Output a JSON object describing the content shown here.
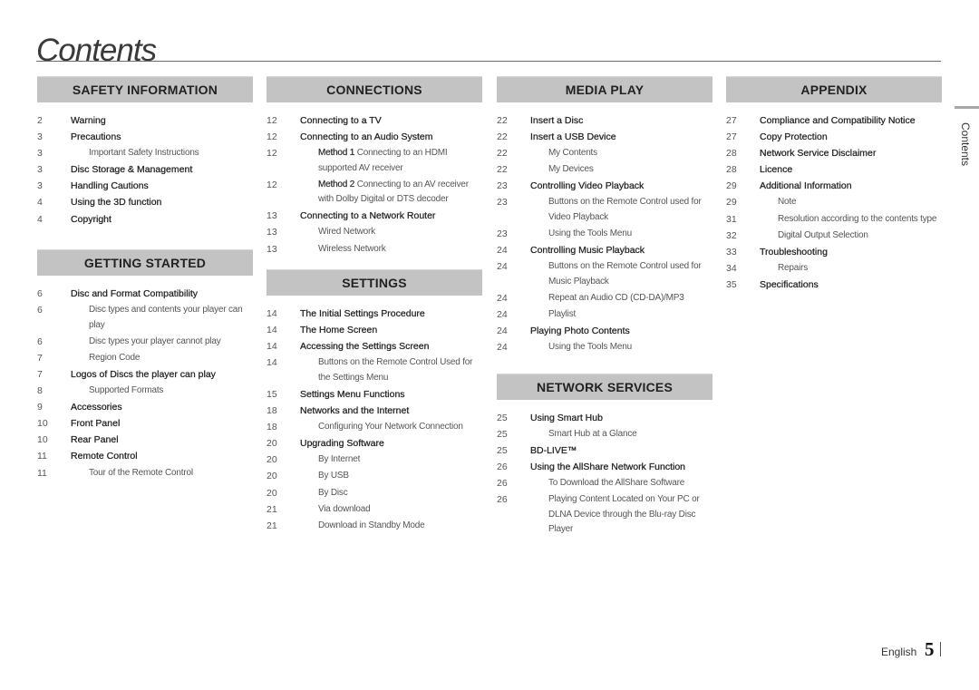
{
  "page": {
    "title": "Contents",
    "side_label": "Contents",
    "footer_language": "English",
    "footer_page_number": "5"
  },
  "columns": [
    {
      "sections": [
        {
          "heading": "SAFETY INFORMATION",
          "entries": [
            {
              "page": "2",
              "text": "Warning",
              "level": 1
            },
            {
              "page": "3",
              "text": "Precautions",
              "level": 1
            },
            {
              "page": "3",
              "text": "Important Safety Instructions",
              "level": 2
            },
            {
              "page": "3",
              "text": "Disc Storage & Management",
              "level": 1
            },
            {
              "page": "3",
              "text": "Handling Cautions",
              "level": 1
            },
            {
              "page": "4",
              "text": "Using the 3D function",
              "level": 1
            },
            {
              "page": "4",
              "text": "Copyright",
              "level": 1
            }
          ]
        },
        {
          "heading": "GETTING STARTED",
          "entries": [
            {
              "page": "6",
              "text": "Disc and Format Compatibility",
              "level": 1
            },
            {
              "page": "6",
              "text": "Disc types and contents your player can play",
              "level": 2
            },
            {
              "page": "6",
              "text": "Disc types your player cannot play",
              "level": 2
            },
            {
              "page": "7",
              "text": "Region Code",
              "level": 2
            },
            {
              "page": "7",
              "text": "Logos of Discs the player can play",
              "level": 1
            },
            {
              "page": "8",
              "text": "Supported Formats",
              "level": 2
            },
            {
              "page": "9",
              "text": "Accessories",
              "level": 1
            },
            {
              "page": "10",
              "text": "Front Panel",
              "level": 1
            },
            {
              "page": "10",
              "text": "Rear Panel",
              "level": 1
            },
            {
              "page": "11",
              "text": "Remote Control",
              "level": 1
            },
            {
              "page": "11",
              "text": "Tour of the Remote Control",
              "level": 2
            }
          ]
        }
      ]
    },
    {
      "sections": [
        {
          "heading": "CONNECTIONS",
          "entries": [
            {
              "page": "12",
              "text": "Connecting to a TV",
              "level": 1
            },
            {
              "page": "12",
              "text": "Connecting to an Audio System",
              "level": 1
            },
            {
              "page": "12",
              "prefix": "Method 1",
              "text": " Connecting to an HDMI supported AV receiver",
              "level": 2
            },
            {
              "page": "12",
              "prefix": "Method 2",
              "text": " Connecting to an AV receiver with Dolby Digital or DTS decoder",
              "level": 2
            },
            {
              "page": "13",
              "text": "Connecting to a Network Router",
              "level": 1
            },
            {
              "page": "13",
              "text": "Wired Network",
              "level": 2
            },
            {
              "page": "13",
              "text": "Wireless Network",
              "level": 2
            }
          ]
        },
        {
          "heading": "SETTINGS",
          "entries": [
            {
              "page": "14",
              "text": "The Initial Settings Procedure",
              "level": 1
            },
            {
              "page": "14",
              "text": "The Home Screen",
              "level": 1
            },
            {
              "page": "14",
              "text": "Accessing the Settings Screen",
              "level": 1
            },
            {
              "page": "14",
              "text": "Buttons on the Remote Control Used for the Settings Menu",
              "level": 2
            },
            {
              "page": "15",
              "text": "Settings Menu Functions",
              "level": 1
            },
            {
              "page": "18",
              "text": "Networks and the Internet",
              "level": 1
            },
            {
              "page": "18",
              "text": "Configuring Your Network Connection",
              "level": 2
            },
            {
              "page": "20",
              "text": "Upgrading Software",
              "level": 1
            },
            {
              "page": "20",
              "text": "By Internet",
              "level": 2
            },
            {
              "page": "20",
              "text": "By USB",
              "level": 2
            },
            {
              "page": "20",
              "text": "By Disc",
              "level": 2
            },
            {
              "page": "21",
              "text": "Via download",
              "level": 2
            },
            {
              "page": "21",
              "text": "Download in Standby Mode",
              "level": 2
            }
          ]
        }
      ]
    },
    {
      "sections": [
        {
          "heading": "MEDIA PLAY",
          "entries": [
            {
              "page": "22",
              "text": "Insert a Disc",
              "level": 1
            },
            {
              "page": "22",
              "text": "Insert a USB Device",
              "level": 1
            },
            {
              "page": "22",
              "text": "My Contents",
              "level": 2
            },
            {
              "page": "22",
              "text": "My Devices",
              "level": 2
            },
            {
              "page": "23",
              "text": "Controlling Video Playback",
              "level": 1
            },
            {
              "page": "23",
              "text": "Buttons on the Remote Control used for Video Playback",
              "level": 2
            },
            {
              "page": "23",
              "text": "Using the Tools Menu",
              "level": 2
            },
            {
              "page": "24",
              "text": "Controlling Music Playback",
              "level": 1
            },
            {
              "page": "24",
              "text": "Buttons on the Remote Control used for Music Playback",
              "level": 2
            },
            {
              "page": "24",
              "text": "Repeat an Audio CD (CD-DA)/MP3",
              "level": 2
            },
            {
              "page": "24",
              "text": "Playlist",
              "level": 2
            },
            {
              "page": "24",
              "text": "Playing Photo Contents",
              "level": 1
            },
            {
              "page": "24",
              "text": "Using the Tools Menu",
              "level": 2
            }
          ]
        },
        {
          "heading": "NETWORK SERVICES",
          "entries": [
            {
              "page": "25",
              "text": "Using Smart Hub",
              "level": 1
            },
            {
              "page": "25",
              "text": "Smart Hub at a Glance",
              "level": 2
            },
            {
              "page": "25",
              "text": "BD-LIVE™",
              "level": 1
            },
            {
              "page": "26",
              "text": "Using the AllShare Network Function",
              "level": 1
            },
            {
              "page": "26",
              "text": "To Download the AllShare Software",
              "level": 2
            },
            {
              "page": "26",
              "text": "Playing Content Located on Your PC or DLNA Device through the Blu-ray Disc Player",
              "level": 2
            }
          ]
        }
      ]
    },
    {
      "sections": [
        {
          "heading": "APPENDIX",
          "entries": [
            {
              "page": "27",
              "text": "Compliance and Compatibility Notice",
              "level": 1
            },
            {
              "page": "27",
              "text": "Copy Protection",
              "level": 1
            },
            {
              "page": "28",
              "text": "Network Service Disclaimer",
              "level": 1
            },
            {
              "page": "28",
              "text": "Licence",
              "level": 1
            },
            {
              "page": "29",
              "text": "Additional Information",
              "level": 1
            },
            {
              "page": "29",
              "text": "Note",
              "level": 2
            },
            {
              "page": "31",
              "text": "Resolution according to the contents type",
              "level": 2
            },
            {
              "page": "32",
              "text": "Digital Output Selection",
              "level": 2
            },
            {
              "page": "33",
              "text": "Troubleshooting",
              "level": 1
            },
            {
              "page": "34",
              "text": "Repairs",
              "level": 2
            },
            {
              "page": "35",
              "text": "Specifications",
              "level": 1
            }
          ]
        }
      ]
    }
  ]
}
